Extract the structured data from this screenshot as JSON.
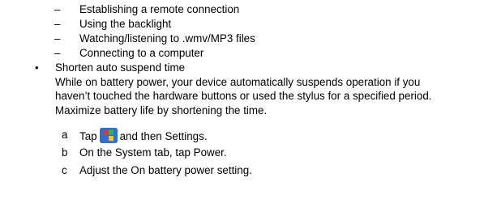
{
  "sub_items": [
    {
      "marker": "–",
      "text": "Establishing a remote connection"
    },
    {
      "marker": "–",
      "text": "Using the backlight"
    },
    {
      "marker": "–",
      "text": "Watching/listening to .wmv/MP3 files"
    },
    {
      "marker": "–",
      "text": "Connecting to a computer"
    }
  ],
  "bullet_item": {
    "marker": "•",
    "heading": "Shorten auto suspend time",
    "body_lines": [
      "While on battery power, your device automatically suspends operation if you",
      "haven’t touched the hardware buttons or used the stylus for a specified period.",
      "Maximize battery life by shortening the time."
    ]
  },
  "steps": [
    {
      "letter": "a",
      "before_icon": "Tap",
      "icon": "windows-start-icon",
      "after_icon": "and then Settings."
    },
    {
      "letter": "b",
      "text": "On the System tab, tap Power."
    },
    {
      "letter": "c",
      "text": "Adjust the On battery power setting."
    }
  ]
}
